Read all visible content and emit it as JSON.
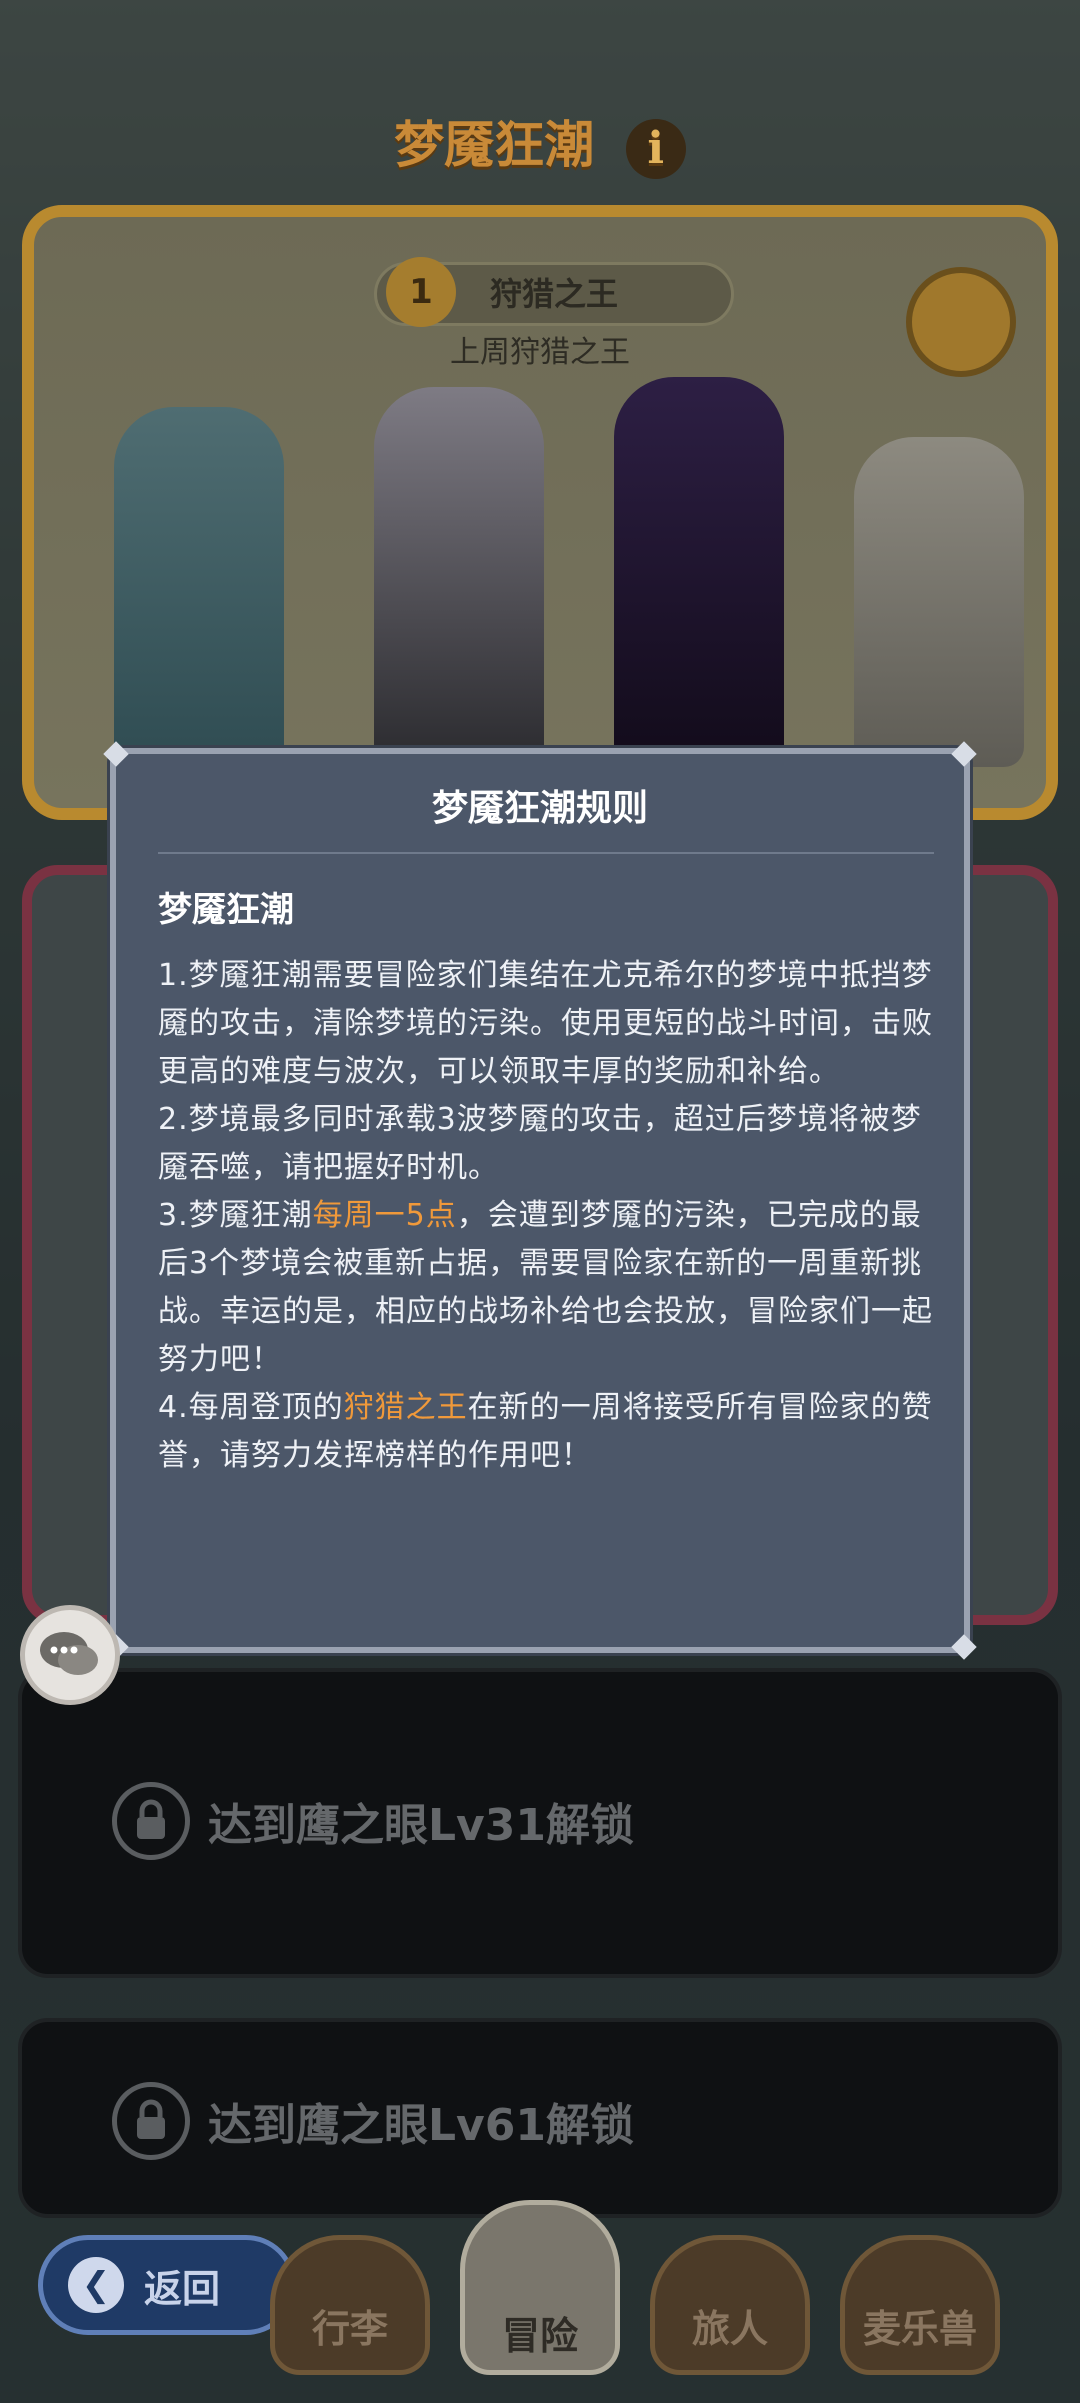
{
  "page": {
    "title": "梦魇狂潮",
    "info_icon": "i"
  },
  "top_card": {
    "rank": "1",
    "badge_label": "狩猎之王",
    "subtitle": "上周狩猎之王"
  },
  "locked": [
    {
      "label": "达到鹰之眼Lv31解锁"
    },
    {
      "label": "达到鹰之眼Lv61解锁"
    }
  ],
  "nav": {
    "back_label": "返回",
    "tabs": [
      "行李",
      "冒险",
      "旅人",
      "麦乐兽"
    ],
    "active_tab": "冒险"
  },
  "modal": {
    "title": "梦魇狂潮规则",
    "heading": "梦魇狂潮",
    "rule1": "1.梦魇狂潮需要冒险家们集结在尤克希尔的梦境中抵挡梦魇的攻击，清除梦境的污染。使用更短的战斗时间，击败更高的难度与波次，可以领取丰厚的奖励和补给。",
    "rule2": "2.梦境最多同时承载3波梦魇的攻击，超过后梦境将被梦魇吞噬，请把握好时机。",
    "rule3_pre": "3.梦魇狂潮",
    "rule3_hl": "每周一5点",
    "rule3_post": "，会遭到梦魇的污染，已完成的最后3个梦境会被重新占据，需要冒险家在新的一周重新挑战。幸运的是，相应的战场补给也会投放，冒险家们一起努力吧！",
    "rule4_pre": "4.每周登顶的",
    "rule4_hl": "狩猎之王",
    "rule4_post": "在新的一周将接受所有冒险家的赞誉，请努力发挥榜样的作用吧！"
  },
  "colors": {
    "highlight": "#f0993a",
    "modal_bg": "#4c5769"
  }
}
